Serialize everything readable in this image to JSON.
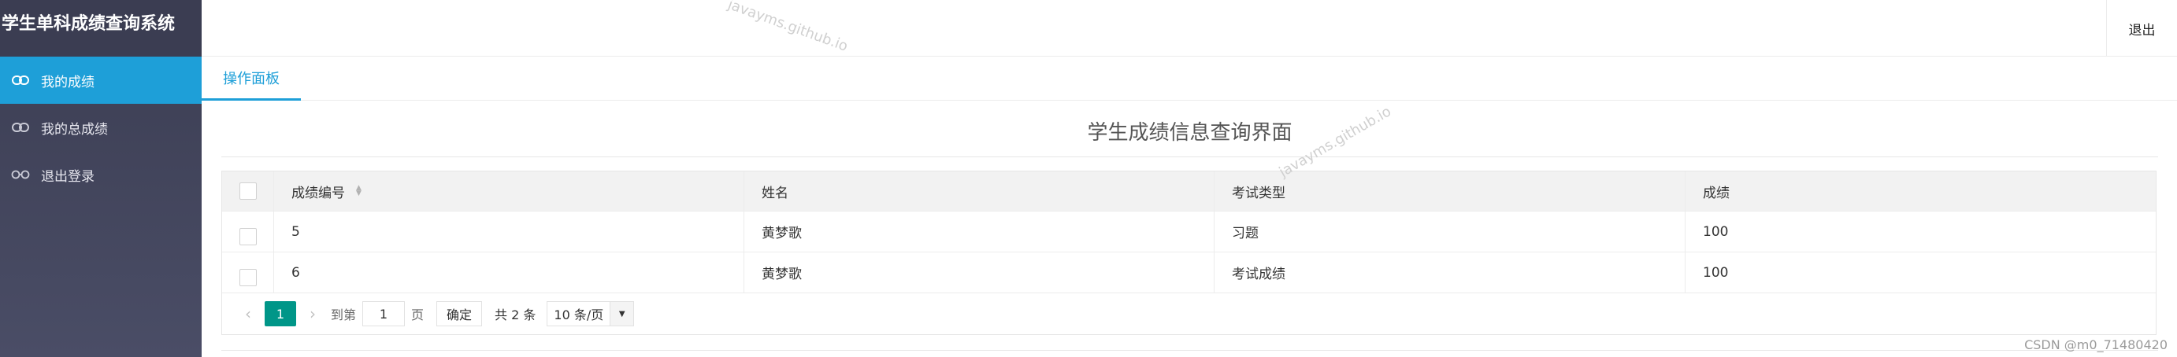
{
  "app": {
    "title": "学生单科成绩查询系统"
  },
  "header": {
    "logout_label": "退出"
  },
  "sidebar": {
    "items": [
      {
        "label": "我的成绩",
        "icon": "link-icon",
        "active": true
      },
      {
        "label": "我的总成绩",
        "icon": "link-icon",
        "active": false
      },
      {
        "label": "退出登录",
        "icon": "glasses-icon",
        "active": false
      }
    ]
  },
  "tabs": [
    {
      "label": "操作面板"
    }
  ],
  "main": {
    "title": "学生成绩信息查询界面",
    "table": {
      "columns": [
        "成绩编号",
        "姓名",
        "考试类型",
        "成绩"
      ],
      "rows": [
        [
          "5",
          "黄梦歌",
          "习题",
          "100"
        ],
        [
          "6",
          "黄梦歌",
          "考试成绩",
          "100"
        ]
      ]
    },
    "pagination": {
      "prev_icon": "chevron-left-icon",
      "next_icon": "chevron-right-icon",
      "current_page": "1",
      "goto_label": "到第",
      "goto_value": "1",
      "page_unit": "页",
      "confirm_label": "确定",
      "total_text": "共 2 条",
      "page_size": "10 条/页"
    }
  },
  "watermarks": [
    "javayms.github.io",
    "javayms.github.io"
  ],
  "footer": {
    "credit": "CSDN @m0_71480420"
  },
  "colors": {
    "sidebar_bg": "#3b3d52",
    "accent": "#1e9fd8",
    "pager_current": "#009688"
  }
}
